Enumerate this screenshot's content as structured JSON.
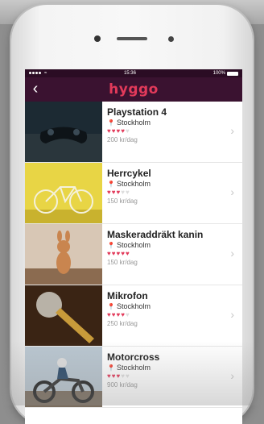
{
  "status_bar": {
    "signal": "●●●●",
    "carrier": "",
    "time": "15:36",
    "battery": "100%"
  },
  "nav": {
    "back_icon": "chevron-left-icon",
    "logo": "hyggo"
  },
  "items": [
    {
      "title": "Playstation 4",
      "location": "Stockholm",
      "rating": 4,
      "price": "200 kr/dag"
    },
    {
      "title": "Herrcykel",
      "location": "Stockholm",
      "rating": 3,
      "price": "150 kr/dag"
    },
    {
      "title": "Maskeraddräkt kanin",
      "location": "Stockholm",
      "rating": 5,
      "price": "150 kr/dag"
    },
    {
      "title": "Mikrofon",
      "location": "Stockholm",
      "rating": 4,
      "price": "250 kr/dag"
    },
    {
      "title": "Motorcross",
      "location": "Stockholm",
      "rating": 3,
      "price": "900 kr/dag"
    }
  ],
  "colors": {
    "navbar": "#3a1230",
    "brand": "#e23a5a"
  }
}
